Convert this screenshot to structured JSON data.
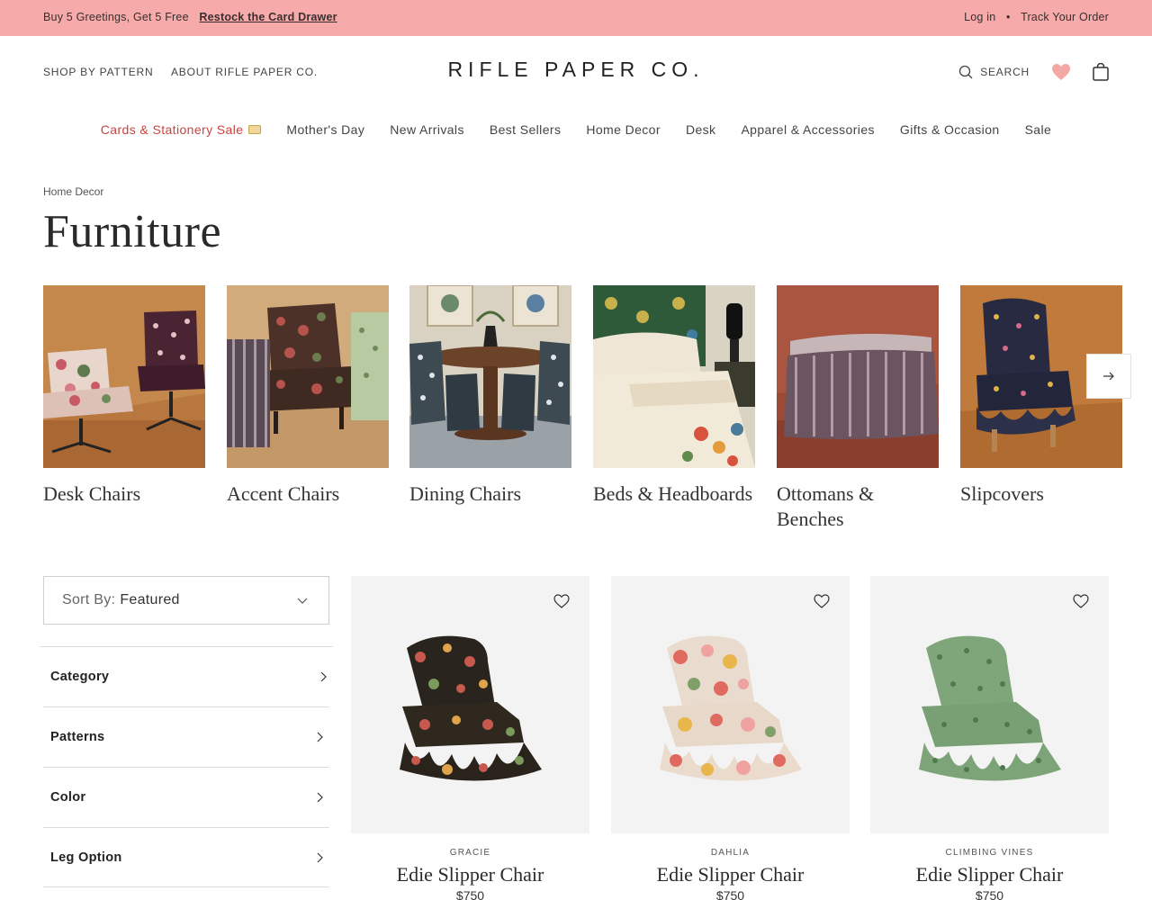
{
  "promo": {
    "message": "Buy 5 Greetings, Get 5 Free",
    "link": "Restock the Card Drawer",
    "login": "Log in",
    "separator": "•",
    "track": "Track Your Order"
  },
  "header": {
    "shop_by_pattern": "SHOP BY PATTERN",
    "about": "ABOUT RIFLE PAPER CO.",
    "logo": "RIFLE PAPER CO.",
    "search": "SEARCH",
    "heart_color": "#f3a8a3"
  },
  "nav": {
    "items": [
      "Cards & Stationery Sale",
      "Mother's Day",
      "New Arrivals",
      "Best Sellers",
      "Home Decor",
      "Desk",
      "Apparel & Accessories",
      "Gifts & Occasion",
      "Sale"
    ],
    "sale_color": "#c9433f"
  },
  "breadcrumb": "Home Decor",
  "title": "Furniture",
  "categories": [
    {
      "label": "Desk Chairs"
    },
    {
      "label": "Accent Chairs"
    },
    {
      "label": "Dining Chairs"
    },
    {
      "label": "Beds & Headboards"
    },
    {
      "label": "Ottomans & Benches"
    },
    {
      "label": "Slipcovers"
    }
  ],
  "sort": {
    "label": "Sort By:",
    "value": "Featured"
  },
  "filters": [
    "Category",
    "Patterns",
    "Color",
    "Leg Option"
  ],
  "products": [
    {
      "pattern": "GRACIE",
      "name": "Edie Slipper Chair",
      "price": "$750"
    },
    {
      "pattern": "DAHLIA",
      "name": "Edie Slipper Chair",
      "price": "$750"
    },
    {
      "pattern": "CLIMBING VINES",
      "name": "Edie Slipper Chair",
      "price": "$750"
    }
  ]
}
